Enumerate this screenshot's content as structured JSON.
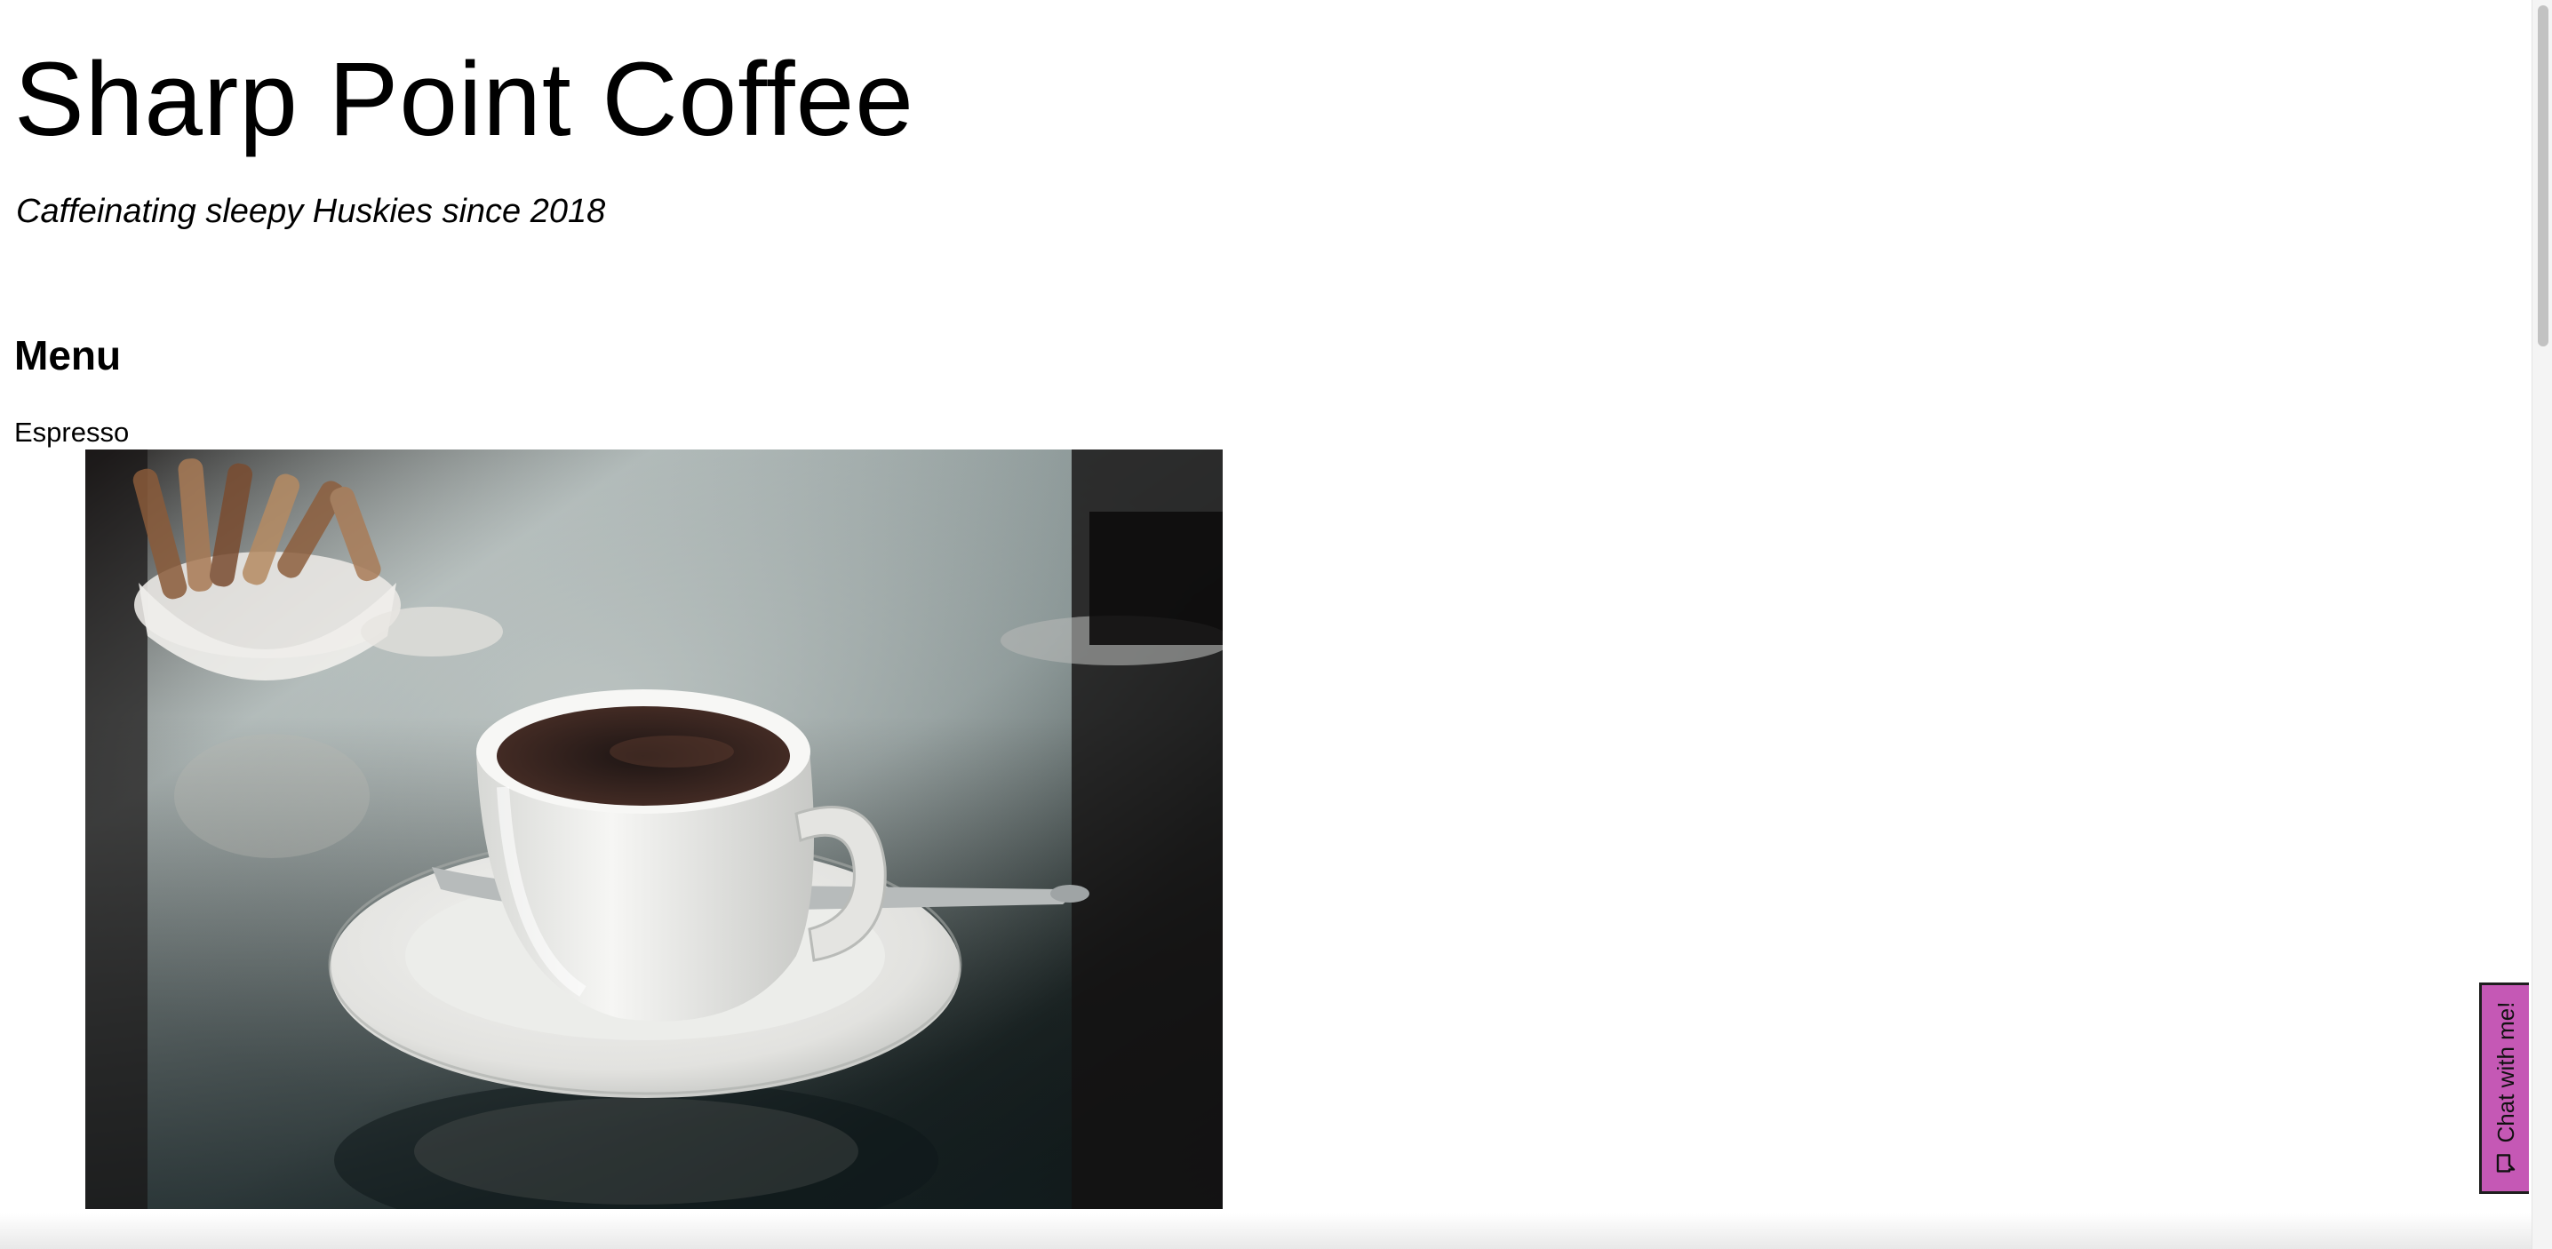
{
  "site": {
    "title": "Sharp Point Coffee",
    "tagline": "Caffeinating sleepy Huskies since 2018"
  },
  "menu": {
    "heading": "Menu",
    "items": [
      {
        "name": "Espresso",
        "image": "coffee-cup-photo"
      }
    ]
  },
  "chat_widget": {
    "label": "Chat with me!",
    "icon": "chat-bubble-icon",
    "background_color": "#c558b5",
    "border_color": "#1e1e1e"
  },
  "colors": {
    "page_background": "#ffffff",
    "text": "#000000"
  }
}
